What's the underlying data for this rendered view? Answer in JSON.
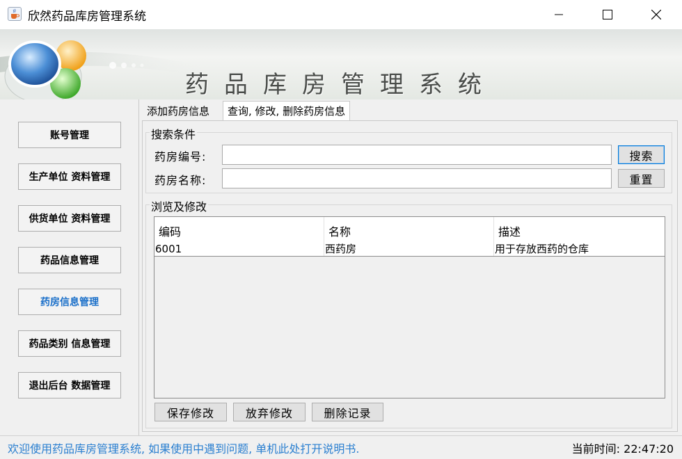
{
  "window": {
    "title": "欣然药品库房管理系统"
  },
  "banner": {
    "title": "药品库房管理系统"
  },
  "sidebar": {
    "items": [
      {
        "label": "账号管理"
      },
      {
        "label": "生产单位 资料管理"
      },
      {
        "label": "供货单位 资料管理"
      },
      {
        "label": "药品信息管理"
      },
      {
        "label": "药房信息管理",
        "active": true
      },
      {
        "label": "药品类别 信息管理"
      },
      {
        "label": "退出后台 数据管理"
      }
    ]
  },
  "tabs": [
    {
      "label": "添加药房信息"
    },
    {
      "label": "查询, 修改, 删除药房信息",
      "selected": true
    }
  ],
  "search": {
    "group_title": "搜索条件",
    "id_label": "药房编号:",
    "id_value": "",
    "name_label": "药房名称:",
    "name_value": "",
    "search_button": "搜索",
    "reset_button": "重置"
  },
  "browse": {
    "group_title": "浏览及修改",
    "columns": [
      "编码",
      "名称",
      "描述"
    ],
    "rows": [
      [
        "6001",
        "西药房",
        "用于存放西药的仓库"
      ]
    ],
    "save_button": "保存修改",
    "discard_button": "放弃修改",
    "delete_button": "删除记录"
  },
  "status": {
    "message": "欢迎使用药品库房管理系统, 如果使用中遇到问题, 单机此处打开说明书.",
    "time": "当前时间: 22:47:20"
  },
  "colors": {
    "accent": "#1a6fc9",
    "status_text": "#2a7fd0",
    "focus_border": "#0078d7"
  }
}
